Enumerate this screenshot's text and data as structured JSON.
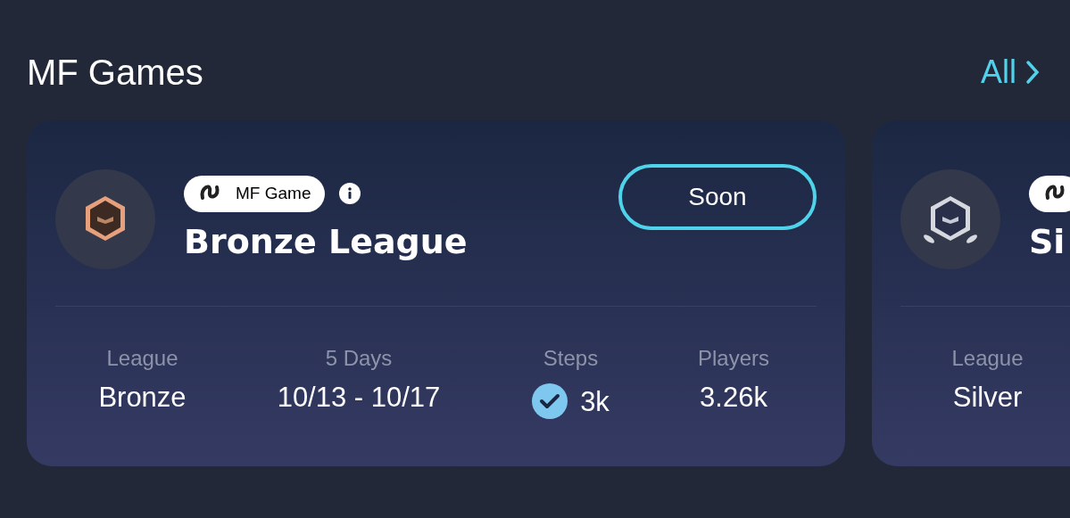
{
  "header": {
    "title": "MF Games",
    "link": "All"
  },
  "cards": [
    {
      "kind": "bronze",
      "tag": "MF Game",
      "title": "Bronze League",
      "button": "Soon",
      "stats": [
        {
          "label": "League",
          "value": "Bronze",
          "checked": false
        },
        {
          "label": "5 Days",
          "value": "10/13 - 10/17",
          "checked": false
        },
        {
          "label": "Steps",
          "value": "3k",
          "checked": true
        },
        {
          "label": "Players",
          "value": "3.26k",
          "checked": false
        }
      ]
    },
    {
      "kind": "silver",
      "title": "Si",
      "stats": [
        {
          "label": "League",
          "value": "Silver",
          "checked": false
        }
      ]
    }
  ]
}
